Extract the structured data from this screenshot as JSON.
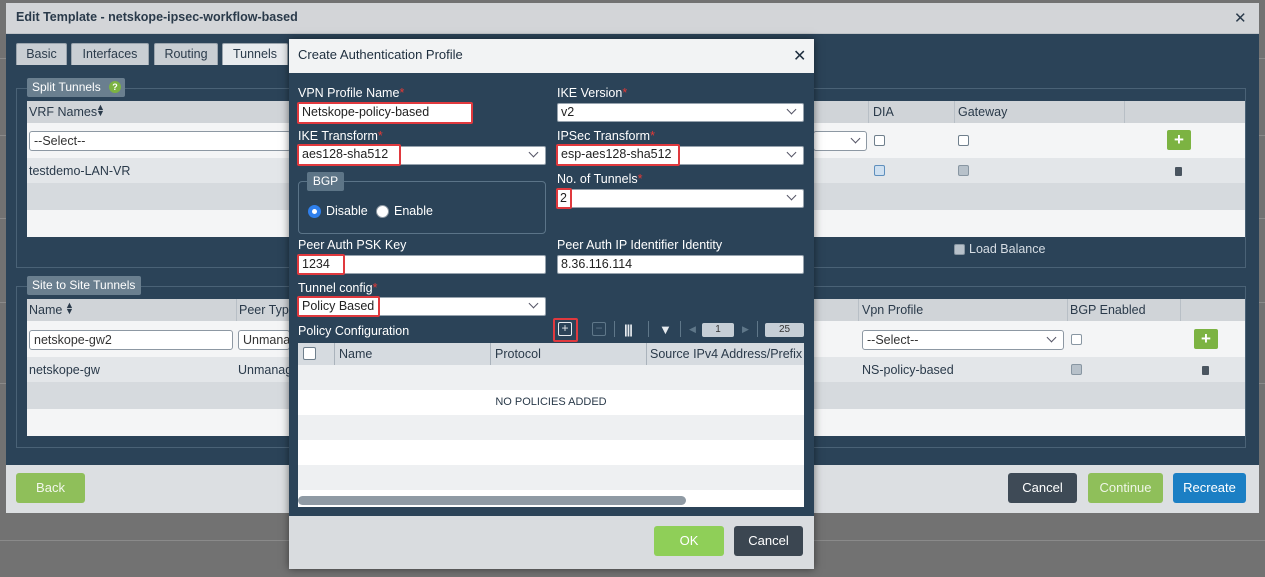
{
  "outer": {
    "title": "Edit Template - netskope-ipsec-workflow-based",
    "close": "✕",
    "tabs": [
      "Basic",
      "Interfaces",
      "Routing",
      "Tunnels"
    ],
    "split_tunnels": {
      "label": "Split Tunnels",
      "help": "?",
      "columns": {
        "vrf": "VRF Names",
        "dia": "DIA",
        "gateway": "Gateway"
      },
      "select_placeholder": "--Select--",
      "rows": [
        {
          "vrf": "testdemo-LAN-VR"
        }
      ],
      "load_balance": "Load Balance"
    },
    "site_tunnels": {
      "label": "Site to Site Tunnels",
      "columns": {
        "name": "Name",
        "peer_type": "Peer Typ",
        "vpn_profile": "Vpn Profile",
        "bgp_enabled": "BGP Enabled"
      },
      "new_row": {
        "name": "netskope-gw2",
        "peer_type": "Unmana",
        "vpn_profile": "--Select--"
      },
      "rows": [
        {
          "name": "netskope-gw",
          "peer_type": "Unmanag",
          "vpn_profile": "NS-policy-based"
        }
      ]
    },
    "footer": {
      "back": "Back",
      "cancel": "Cancel",
      "continue": "Continue",
      "recreate": "Recreate"
    }
  },
  "modal": {
    "title": "Create Authentication Profile",
    "close": "✕",
    "required_mark": "*",
    "vpn_profile_name": {
      "label": "VPN Profile Name",
      "value": "Netskope-policy-based"
    },
    "ike_version": {
      "label": "IKE Version",
      "value": "v2"
    },
    "ike_transform": {
      "label": "IKE Transform",
      "value": "aes128-sha512"
    },
    "ipsec_transform": {
      "label": "IPSec Transform",
      "value": "esp-aes128-sha512"
    },
    "bgp": {
      "label": "BGP",
      "disable": "Disable",
      "enable": "Enable",
      "selected": "Disable"
    },
    "num_tunnels": {
      "label": "No. of Tunnels",
      "value": "2"
    },
    "psk": {
      "label": "Peer Auth PSK Key",
      "value": "1234"
    },
    "peer_ip_identity": {
      "label": "Peer Auth IP Identifier Identity",
      "value": "8.36.116.114"
    },
    "tunnel_config": {
      "label": "Tunnel config",
      "value": "Policy Based"
    },
    "policy": {
      "label": "Policy Configuration",
      "page": "1",
      "page_size": "25",
      "columns": [
        "Name",
        "Protocol",
        "Source IPv4 Address/Prefix"
      ],
      "empty": "NO POLICIES ADDED"
    },
    "ok": "OK",
    "cancel": "Cancel"
  },
  "colors": {
    "accent_green": "#7cb342",
    "accent_blue": "#1b7fc4",
    "highlight_red": "#e0393e",
    "panel": "#2b4358"
  }
}
